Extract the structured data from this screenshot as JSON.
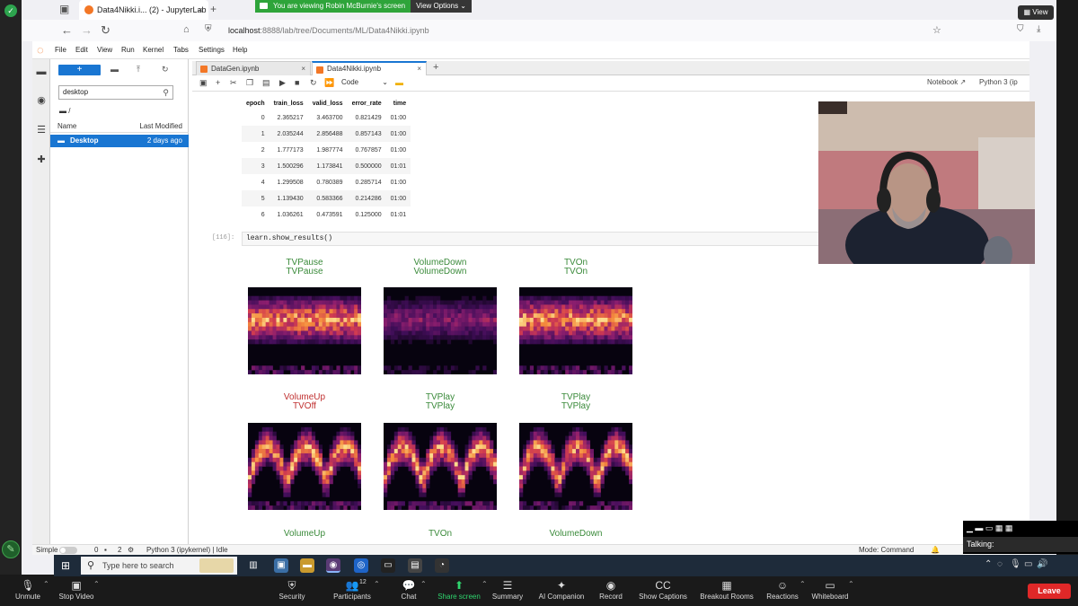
{
  "zoom": {
    "banner_message": "You are viewing Robin McBurnie's screen",
    "view_options": "View Options ⌄",
    "view_button": "▦ View",
    "talking_label": "Talking:",
    "controls": [
      {
        "id": "unmute",
        "label": "Unmute",
        "icon": "🎙"
      },
      {
        "id": "stop-video",
        "label": "Stop Video",
        "icon": "▣"
      },
      {
        "id": "security",
        "label": "Security",
        "icon": "⛨"
      },
      {
        "id": "participants",
        "label": "Participants",
        "icon": "👥",
        "count": "12"
      },
      {
        "id": "chat",
        "label": "Chat",
        "icon": "💬"
      },
      {
        "id": "share-screen",
        "label": "Share screen",
        "icon": "⬆"
      },
      {
        "id": "summary",
        "label": "Summary",
        "icon": "☰"
      },
      {
        "id": "ai-companion",
        "label": "AI Companion",
        "icon": "✦"
      },
      {
        "id": "record",
        "label": "Record",
        "icon": "◉"
      },
      {
        "id": "show-captions",
        "label": "Show Captions",
        "icon": "CC"
      },
      {
        "id": "breakout-rooms",
        "label": "Breakout Rooms",
        "icon": "▦"
      },
      {
        "id": "reactions",
        "label": "Reactions",
        "icon": "☺"
      },
      {
        "id": "whiteboard",
        "label": "Whiteboard",
        "icon": "▭"
      }
    ],
    "leave": "Leave"
  },
  "browser": {
    "tab_title": "Data4Nikki.i... (2) - JupyterLab",
    "url_host": "localhost",
    "url_rest": ":8888/lab/tree/Documents/ML/Data4Nikki.ipynb"
  },
  "jupyter": {
    "menu": [
      "File",
      "Edit",
      "View",
      "Run",
      "Kernel",
      "Tabs",
      "Settings",
      "Help"
    ],
    "filebrowser": {
      "search_value": "desktop",
      "breadcrumb": "/",
      "col_name": "Name",
      "col_modified": "Last Modified",
      "rows": [
        {
          "name": "Desktop",
          "modified": "2 days ago"
        }
      ]
    },
    "tabs": [
      {
        "label": "DataGen.ipynb",
        "active": false
      },
      {
        "label": "Data4Nikki.ipynb",
        "active": true
      }
    ],
    "toolbar": {
      "cell_type": "Code",
      "notebook_label": "Notebook",
      "kernel_label": "Python 3 (ip"
    },
    "results_table": {
      "headers": [
        "epoch",
        "train_loss",
        "valid_loss",
        "error_rate",
        "time"
      ],
      "rows": [
        [
          "0",
          "2.365217",
          "3.463700",
          "0.821429",
          "01:00"
        ],
        [
          "1",
          "2.035244",
          "2.856488",
          "0.857143",
          "01:00"
        ],
        [
          "2",
          "1.777173",
          "1.987774",
          "0.767857",
          "01:00"
        ],
        [
          "3",
          "1.500296",
          "1.173841",
          "0.500000",
          "01:01"
        ],
        [
          "4",
          "1.299508",
          "0.780389",
          "0.285714",
          "01:00"
        ],
        [
          "5",
          "1.139430",
          "0.583366",
          "0.214286",
          "01:00"
        ],
        [
          "6",
          "1.036261",
          "0.473591",
          "0.125000",
          "01:01"
        ]
      ]
    },
    "cell": {
      "prompt": "[116]:",
      "code": "learn.show_results()"
    },
    "results": [
      {
        "actual": "TVPause",
        "predicted": "TVPause",
        "correct": true
      },
      {
        "actual": "VolumeDown",
        "predicted": "VolumeDown",
        "correct": true
      },
      {
        "actual": "TVOn",
        "predicted": "TVOn",
        "correct": true
      },
      {
        "actual": "VolumeUp",
        "predicted": "TVOff",
        "correct": false
      },
      {
        "actual": "TVPlay",
        "predicted": "TVPlay",
        "correct": true
      },
      {
        "actual": "TVPlay",
        "predicted": "TVPlay",
        "correct": true
      },
      {
        "actual": "VolumeUp",
        "predicted": "",
        "correct": true
      },
      {
        "actual": "TVOn",
        "predicted": "",
        "correct": true
      },
      {
        "actual": "VolumeDown",
        "predicted": "",
        "correct": true
      }
    ],
    "status": {
      "simple": "Simple",
      "count_a": "0",
      "count_b": "2",
      "kernel": "Python 3 (ipykernel) | Idle",
      "mode": "Mode: Command"
    }
  },
  "taskbar": {
    "search_placeholder": "Type here to search"
  }
}
